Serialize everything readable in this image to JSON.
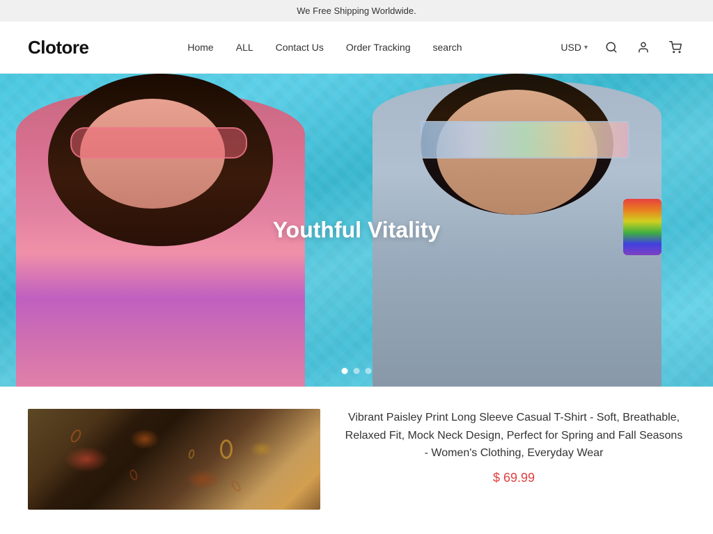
{
  "announcement": {
    "text": "We Free Shipping Worldwide."
  },
  "header": {
    "logo": "Clotore",
    "nav": [
      {
        "label": "Home",
        "id": "home"
      },
      {
        "label": "ALL",
        "id": "all"
      },
      {
        "label": "Contact Us",
        "id": "contact"
      },
      {
        "label": "Order Tracking",
        "id": "order-tracking"
      },
      {
        "label": "search",
        "id": "search-nav"
      }
    ],
    "currency": {
      "label": "USD",
      "arrow": "▾"
    },
    "icons": {
      "search": "🔍",
      "account": "👤",
      "cart": "🛒"
    }
  },
  "hero": {
    "title": "Youthful Vitality",
    "dots": [
      {
        "active": true
      },
      {
        "active": false
      },
      {
        "active": false
      }
    ]
  },
  "product": {
    "title": "Vibrant Paisley Print Long Sleeve Casual T-Shirt - Soft, Breathable, Relaxed Fit, Mock Neck Design, Perfect for Spring and Fall Seasons - Women's Clothing, Everyday Wear",
    "price": "$ 69.99"
  }
}
